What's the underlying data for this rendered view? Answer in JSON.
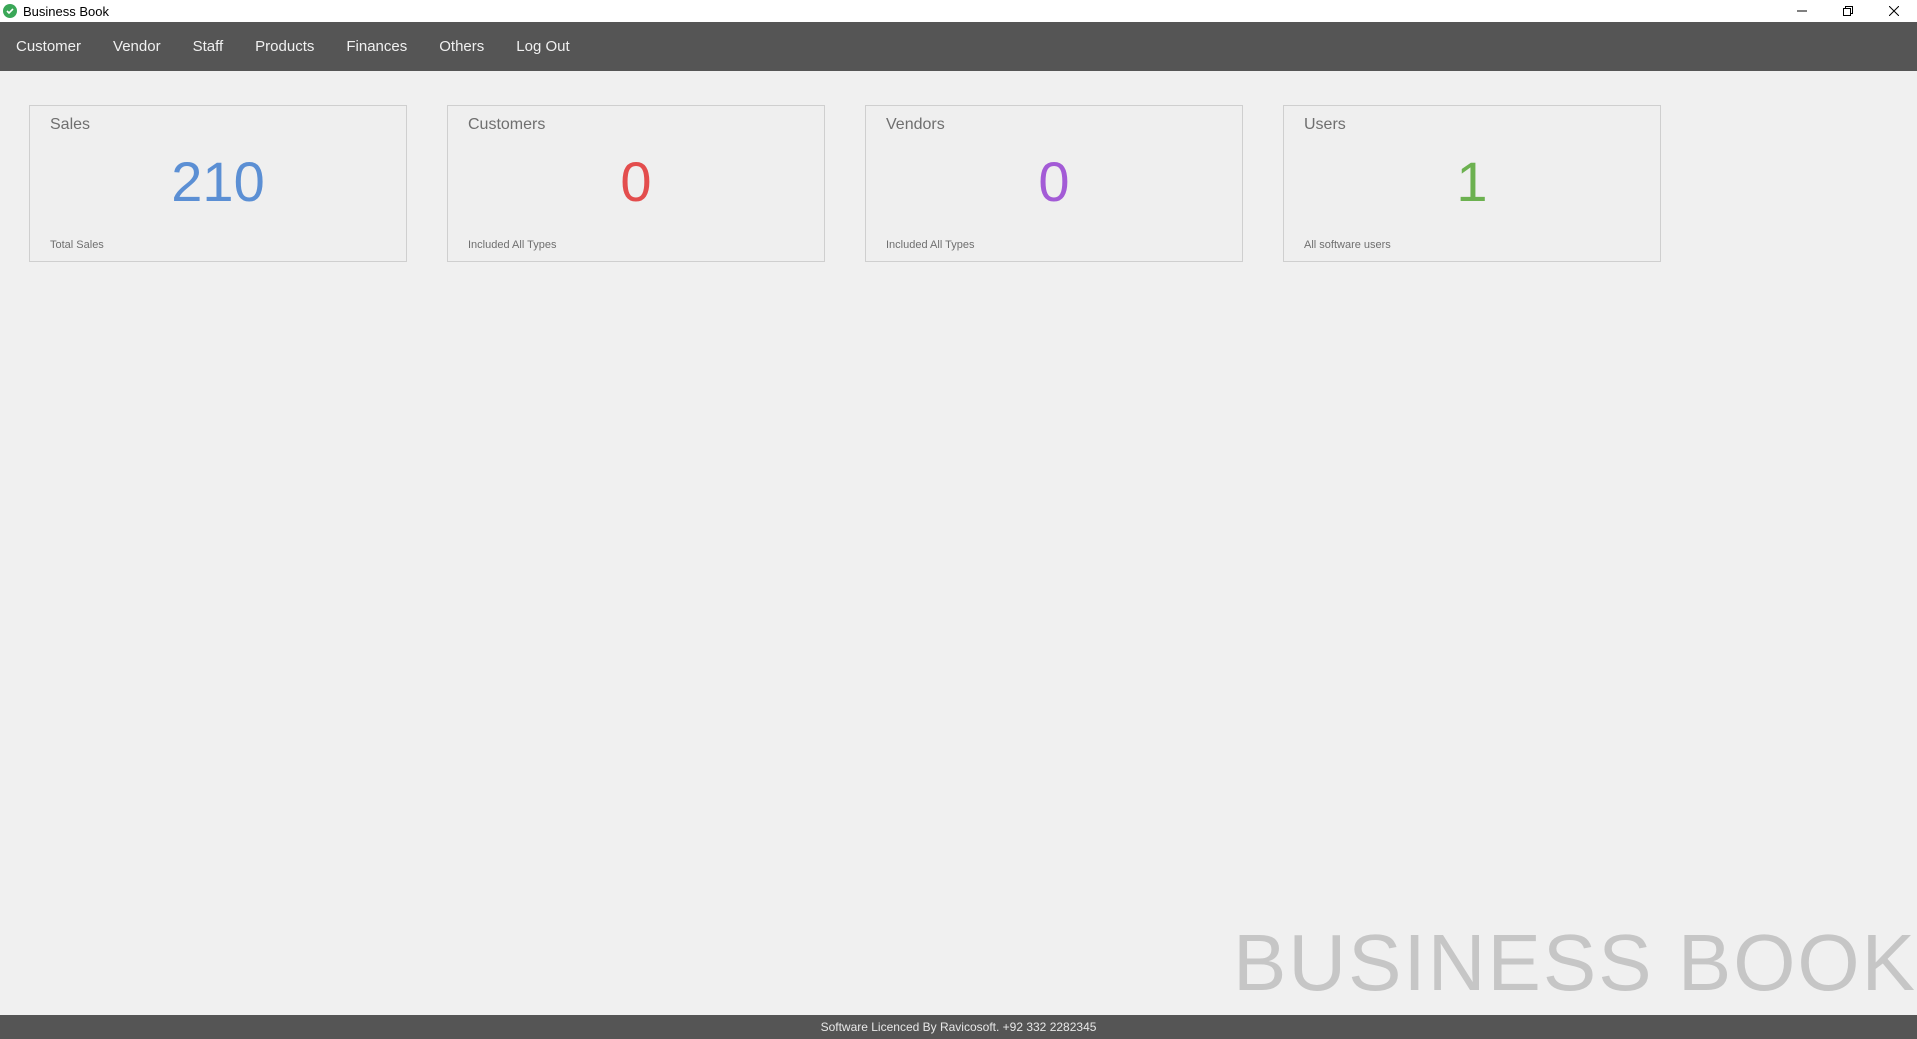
{
  "window": {
    "title": "Business Book",
    "icon": "check-circle-icon"
  },
  "menu": {
    "items": [
      {
        "label": "Customer"
      },
      {
        "label": "Vendor"
      },
      {
        "label": "Staff"
      },
      {
        "label": "Products"
      },
      {
        "label": "Finances"
      },
      {
        "label": "Others"
      },
      {
        "label": "Log Out"
      }
    ]
  },
  "cards": [
    {
      "title": "Sales",
      "value": "210",
      "subtitle": "Total Sales",
      "color": "#5b8fd4"
    },
    {
      "title": "Customers",
      "value": "0",
      "subtitle": "Included All Types",
      "color": "#e34d4d"
    },
    {
      "title": "Vendors",
      "value": "0",
      "subtitle": "Included All Types",
      "color": "#a35bd6"
    },
    {
      "title": "Users",
      "value": "1",
      "subtitle": "All software users",
      "color": "#6cb150"
    }
  ],
  "watermark": "BUSINESS BOOK",
  "footer": {
    "text": "Software Licenced By Ravicosoft. +92 332 2282345"
  },
  "colors": {
    "menubar": "#555555",
    "background": "#f0f0f0"
  }
}
